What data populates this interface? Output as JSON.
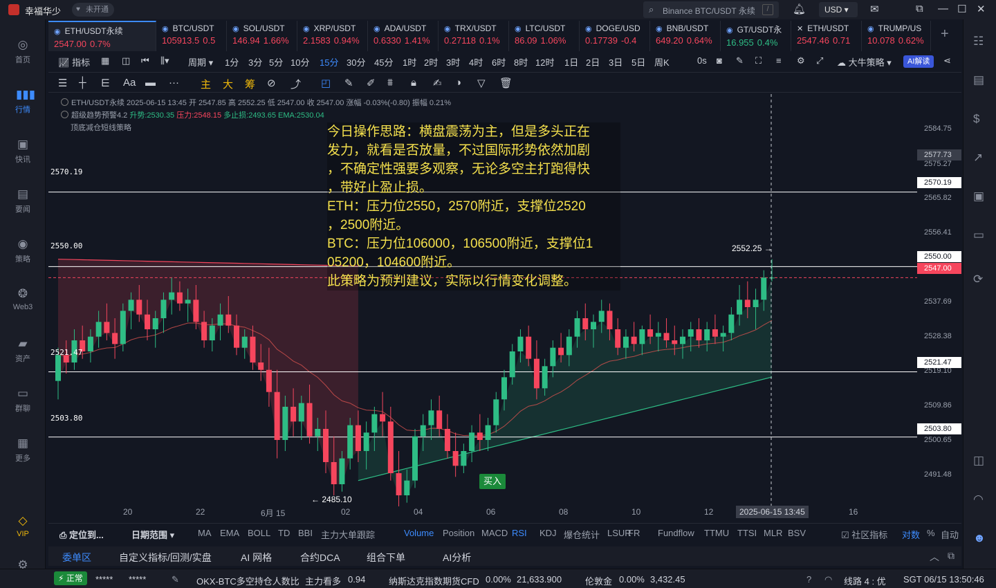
{
  "titlebar": {
    "app_name": "幸福华少",
    "vip_badge": "未开通",
    "search_placeholder": "Binance BTC/USDT 永续",
    "search_shortcut": "/",
    "currency": "USD ▾"
  },
  "sidebar": {
    "items": [
      {
        "label": "首页",
        "icon": "home-icon"
      },
      {
        "label": "行情",
        "icon": "chart-icon"
      },
      {
        "label": "快讯",
        "icon": "news-icon"
      },
      {
        "label": "要闻",
        "icon": "article-icon"
      },
      {
        "label": "策略",
        "icon": "strategy-icon"
      },
      {
        "label": "Web3",
        "icon": "web3-icon"
      },
      {
        "label": "资产",
        "icon": "wallet-icon"
      },
      {
        "label": "群聊",
        "icon": "chat-icon"
      },
      {
        "label": "更多",
        "icon": "grid-icon"
      },
      {
        "label": "VIP",
        "icon": "diamond-icon"
      }
    ]
  },
  "tabs": [
    {
      "name": "ETH/USDT永续",
      "price": "2547.00",
      "change": "0.7%",
      "dir": "dn",
      "active": true
    },
    {
      "name": "BTC/USDT",
      "price": "105913.5",
      "change": "0.5",
      "dir": "dn"
    },
    {
      "name": "SOL/USDT",
      "price": "146.94",
      "change": "1.66%",
      "dir": "dn"
    },
    {
      "name": "XRP/USDT",
      "price": "2.1583",
      "change": "0.94%",
      "dir": "dn"
    },
    {
      "name": "ADA/USDT",
      "price": "0.6330",
      "change": "1.41%",
      "dir": "dn"
    },
    {
      "name": "TRX/USDT",
      "price": "0.27118",
      "change": "0.1%",
      "dir": "dn"
    },
    {
      "name": "LTC/USDT",
      "price": "86.09",
      "change": "1.06%",
      "dir": "dn"
    },
    {
      "name": "DOGE/USD",
      "price": "0.17739",
      "change": "-0.4",
      "dir": "dn"
    },
    {
      "name": "BNB/USDT",
      "price": "649.20",
      "change": "0.64%",
      "dir": "dn"
    },
    {
      "name": "GT/USDT永",
      "price": "16.955",
      "change": "0.4%",
      "dir": "up"
    },
    {
      "name": "ETH/USDT",
      "price": "2547.46",
      "change": "0.71",
      "dir": "dn",
      "x": true
    },
    {
      "name": "TRUMP/US",
      "price": "10.078",
      "change": "0.62%",
      "dir": "dn"
    }
  ],
  "periodbar": {
    "indicator_label": "指标",
    "period_label": "周期",
    "periods": [
      "1分",
      "3分",
      "5分",
      "10分",
      "15分",
      "30分",
      "45分",
      "1时",
      "2时",
      "3时",
      "4时",
      "6时",
      "8时",
      "12时",
      "1日",
      "2日",
      "3日",
      "5日",
      "周K"
    ],
    "selected": "15分",
    "seconds": "0s",
    "strategy": "大牛策略",
    "ai_button": "AI解读"
  },
  "drawbar": {
    "font_label": "Aa",
    "main_label": "主",
    "big_label": "大",
    "chip_label": "筹"
  },
  "legend": {
    "line1": "ETH/USDT永续  2025-06-15 13:45  开 2547.85  高 2552.25  低 2547.00  收 2547.00  涨幅 -0.03%(-0.80)  振幅 0.21%",
    "line2_name": "超级趋势预警4.2",
    "line2_up": "升势:2530.35",
    "line2_press": "压力:2548.15",
    "line2_stop": "多止损:2493.65",
    "line2_ema": "EMA:2530.04",
    "line3": "顶底减仓短线策略"
  },
  "annotation": [
    "今日操作思路：横盘震荡为主，但是多头正在",
    "发力，就看是否放量，不过国际形势依然加剧",
    "，不确定性强要多观察，无论多空主打跑得快",
    "，带好止盈止损。",
    "ETH：压力位2550，2570附近，支撑位2520",
    "，2500附近。",
    "BTC：压力位106000，106500附近，支撑位1",
    "05200，104600附近。",
    "此策略为预判建议，实际以行情变化调整。"
  ],
  "chart_data": {
    "type": "candlestick",
    "symbol": "ETH/USDT永续",
    "interval": "15分",
    "ylim": [
      2485,
      2590
    ],
    "y_ticks": [
      "2584.75",
      "2575.27",
      "2565.82",
      "2556.41",
      "2537.69",
      "2528.38",
      "2519.10",
      "2509.86",
      "2500.65",
      "2491.48"
    ],
    "x_ticks": [
      "20",
      "22",
      "6月 15",
      "02",
      "04",
      "06",
      "08",
      "10",
      "12",
      "16"
    ],
    "x_cursor": "2025-06-15 13:45",
    "crosshair_price": "2577.73",
    "last_price": "2547.00",
    "horizontal_lines": [
      {
        "price": "2570.19"
      },
      {
        "price": "2550.00"
      },
      {
        "price": "2521.47"
      },
      {
        "price": "2503.80"
      }
    ],
    "high_marker": "2552.25",
    "low_marker": "2485.10",
    "signal": "买入",
    "candles_ohlc": [
      [
        2519,
        2528,
        2514,
        2526
      ],
      [
        2526,
        2530,
        2521,
        2524
      ],
      [
        2524,
        2533,
        2522,
        2530
      ],
      [
        2530,
        2534,
        2525,
        2527
      ],
      [
        2527,
        2533,
        2524,
        2531
      ],
      [
        2531,
        2538,
        2528,
        2535
      ],
      [
        2535,
        2540,
        2530,
        2532
      ],
      [
        2532,
        2536,
        2525,
        2529
      ],
      [
        2529,
        2540,
        2527,
        2538
      ],
      [
        2538,
        2543,
        2533,
        2541
      ],
      [
        2541,
        2545,
        2535,
        2537
      ],
      [
        2537,
        2541,
        2530,
        2533
      ],
      [
        2533,
        2538,
        2528,
        2536
      ],
      [
        2536,
        2543,
        2532,
        2541
      ],
      [
        2541,
        2547,
        2537,
        2543
      ],
      [
        2543,
        2546,
        2538,
        2540
      ],
      [
        2540,
        2544,
        2535,
        2541
      ],
      [
        2541,
        2545,
        2533,
        2535
      ],
      [
        2535,
        2538,
        2528,
        2530
      ],
      [
        2530,
        2536,
        2527,
        2534
      ],
      [
        2534,
        2540,
        2530,
        2537
      ],
      [
        2537,
        2542,
        2532,
        2534
      ],
      [
        2534,
        2537,
        2526,
        2528
      ],
      [
        2528,
        2533,
        2525,
        2531
      ],
      [
        2531,
        2534,
        2522,
        2524
      ],
      [
        2524,
        2529,
        2519,
        2522
      ],
      [
        2522,
        2528,
        2512,
        2516
      ],
      [
        2516,
        2522,
        2498,
        2503
      ],
      [
        2503,
        2515,
        2500,
        2512
      ],
      [
        2512,
        2517,
        2504,
        2508
      ],
      [
        2508,
        2515,
        2503,
        2513
      ],
      [
        2513,
        2518,
        2502,
        2504
      ],
      [
        2504,
        2509,
        2500,
        2506
      ],
      [
        2506,
        2511,
        2494,
        2497
      ],
      [
        2497,
        2504,
        2488,
        2491
      ],
      [
        2491,
        2500,
        2489,
        2498
      ],
      [
        2498,
        2509,
        2495,
        2507
      ],
      [
        2507,
        2511,
        2497,
        2500
      ],
      [
        2500,
        2508,
        2495,
        2505
      ],
      [
        2505,
        2512,
        2500,
        2510
      ],
      [
        2510,
        2516,
        2504,
        2508
      ],
      [
        2508,
        2512,
        2492,
        2494
      ],
      [
        2494,
        2500,
        2485,
        2488
      ],
      [
        2488,
        2495,
        2486,
        2492
      ],
      [
        2492,
        2506,
        2490,
        2504
      ],
      [
        2504,
        2510,
        2500,
        2507
      ],
      [
        2507,
        2514,
        2503,
        2511
      ],
      [
        2511,
        2515,
        2504,
        2506
      ],
      [
        2506,
        2510,
        2498,
        2500
      ],
      [
        2500,
        2505,
        2493,
        2496
      ],
      [
        2496,
        2502,
        2494,
        2500
      ],
      [
        2500,
        2507,
        2497,
        2505
      ],
      [
        2505,
        2510,
        2500,
        2503
      ],
      [
        2503,
        2509,
        2500,
        2507
      ],
      [
        2507,
        2516,
        2505,
        2514
      ],
      [
        2514,
        2522,
        2511,
        2520
      ],
      [
        2520,
        2529,
        2518,
        2527
      ],
      [
        2527,
        2533,
        2524,
        2531
      ],
      [
        2531,
        2534,
        2523,
        2525
      ],
      [
        2525,
        2530,
        2514,
        2517
      ],
      [
        2517,
        2525,
        2515,
        2523
      ],
      [
        2523,
        2530,
        2520,
        2528
      ],
      [
        2528,
        2532,
        2524,
        2526
      ],
      [
        2526,
        2533,
        2523,
        2531
      ],
      [
        2531,
        2538,
        2528,
        2536
      ],
      [
        2536,
        2540,
        2530,
        2533
      ],
      [
        2533,
        2537,
        2528,
        2535
      ],
      [
        2535,
        2541,
        2532,
        2538
      ],
      [
        2538,
        2540,
        2530,
        2533
      ],
      [
        2533,
        2536,
        2526,
        2528
      ],
      [
        2528,
        2533,
        2525,
        2531
      ],
      [
        2531,
        2535,
        2527,
        2529
      ],
      [
        2529,
        2534,
        2526,
        2533
      ],
      [
        2533,
        2537,
        2529,
        2531
      ],
      [
        2531,
        2535,
        2527,
        2532
      ],
      [
        2532,
        2536,
        2528,
        2530
      ],
      [
        2530,
        2534,
        2526,
        2529
      ],
      [
        2529,
        2533,
        2525,
        2531
      ],
      [
        2531,
        2535,
        2527,
        2533
      ],
      [
        2533,
        2536,
        2528,
        2530
      ],
      [
        2530,
        2535,
        2527,
        2533
      ],
      [
        2533,
        2537,
        2529,
        2531
      ],
      [
        2531,
        2534,
        2527,
        2532
      ],
      [
        2532,
        2539,
        2530,
        2537
      ],
      [
        2537,
        2545,
        2534,
        2541
      ],
      [
        2541,
        2546,
        2536,
        2539
      ],
      [
        2539,
        2544,
        2533,
        2541
      ],
      [
        2541,
        2549,
        2538,
        2547
      ],
      [
        2547,
        2552,
        2546,
        2547
      ]
    ]
  },
  "indicators": {
    "locate": "定位到...",
    "range": "日期范围",
    "items": [
      "MA",
      "EMA",
      "BOLL",
      "TD",
      "BBI",
      "主力大单跟踪",
      "Volume",
      "Position",
      "MACD",
      "RSI",
      "KDJ",
      "爆仓统计",
      "LSUR",
      "FR",
      "Fundflow",
      "TTMU",
      "TTSI",
      "MLR",
      "BSV"
    ],
    "selected": [
      "Volume",
      "RSI"
    ],
    "community": "社区指标",
    "log": "对数",
    "percent": "%",
    "auto": "自动"
  },
  "panel_tabs": [
    "委单区",
    "自定义指标/回测/实盘",
    "AI 网格",
    "合约DCA",
    "组合下单",
    "AI分析"
  ],
  "statusbar": {
    "status": "正常",
    "mask1": "*****",
    "mask2": "*****",
    "ticker1": "OKX-BTC多空持仓人数比",
    "ticker1_val": "主力看多",
    "ticker1_num": "0.94",
    "ticker2": "纳斯达克指数期货CFD",
    "ticker2_pct": "0.00%",
    "ticker2_val": "21,633.900",
    "ticker3": "伦敦金",
    "ticker3_pct": "0.00%",
    "ticker3_val": "3,432.45",
    "line": "线路 4 : 优",
    "time": "SGT 06/15 13:50:46"
  },
  "colors": {
    "up": "#2ebd85",
    "down": "#f6465d",
    "accent": "#3d8bfd",
    "annotation": "#f4e04d"
  }
}
